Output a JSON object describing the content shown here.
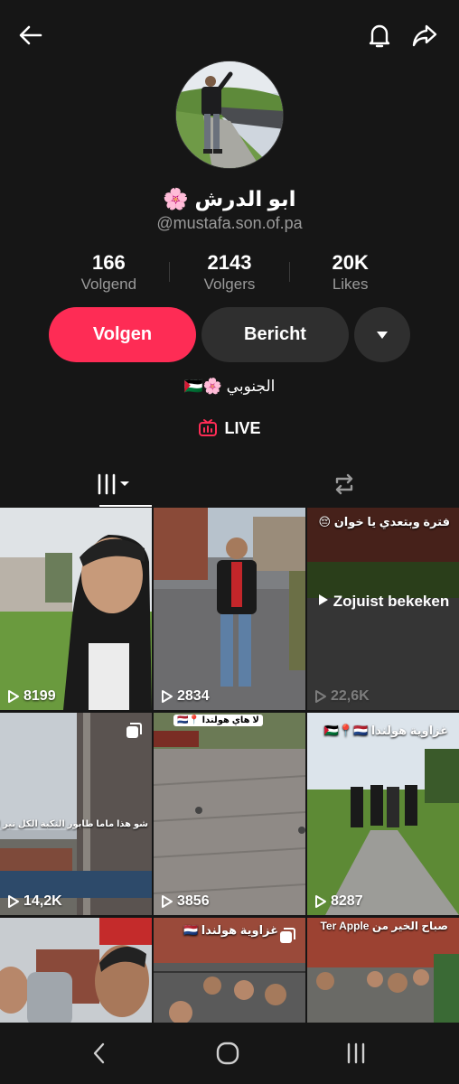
{
  "header": {
    "back_icon": "arrow-left-icon",
    "bell_icon": "bell-icon",
    "share_icon": "share-arrow-icon"
  },
  "profile": {
    "display_name": "ابو الدرش 🌸",
    "handle": "@mustafa.son.of.pa",
    "stats": [
      {
        "value": "166",
        "label": "Volgend"
      },
      {
        "value": "2143",
        "label": "Volgers"
      },
      {
        "value": "20K",
        "label": "Likes"
      }
    ],
    "follow_label": "Volgen",
    "message_label": "Bericht",
    "bio": "الجنوبي 🌸🇵🇸",
    "live_label": "LIVE"
  },
  "tabs": [
    {
      "icon": "grid-icon"
    },
    {
      "icon": "repost-icon"
    }
  ],
  "videos": [
    {
      "views": "8199"
    },
    {
      "views": "2834"
    },
    {
      "views": "22,6K",
      "watched_label": "Zojuist bekeken",
      "caption": "فترة وبتعدي يا خوان 😔"
    },
    {
      "views": "14,2K",
      "caption": "شو هذا ماما طابور النكبة الكل نير ابل 🇳🇱"
    },
    {
      "views": "3856",
      "caption": "لا هاي هولندا 📍🇳🇱"
    },
    {
      "views": "8287",
      "caption": "غزاوية هولندا 🇵🇸📍🇳🇱"
    },
    {
      "caption": ""
    },
    {
      "caption": "غزاوية هولندا 🇳🇱"
    },
    {
      "caption": "صباح الخير من Ter Apple"
    }
  ],
  "colors": {
    "accent": "#fe2c55",
    "background": "#161616",
    "secondary_button": "#2f2f2f",
    "muted_text": "#9a9a9a"
  }
}
